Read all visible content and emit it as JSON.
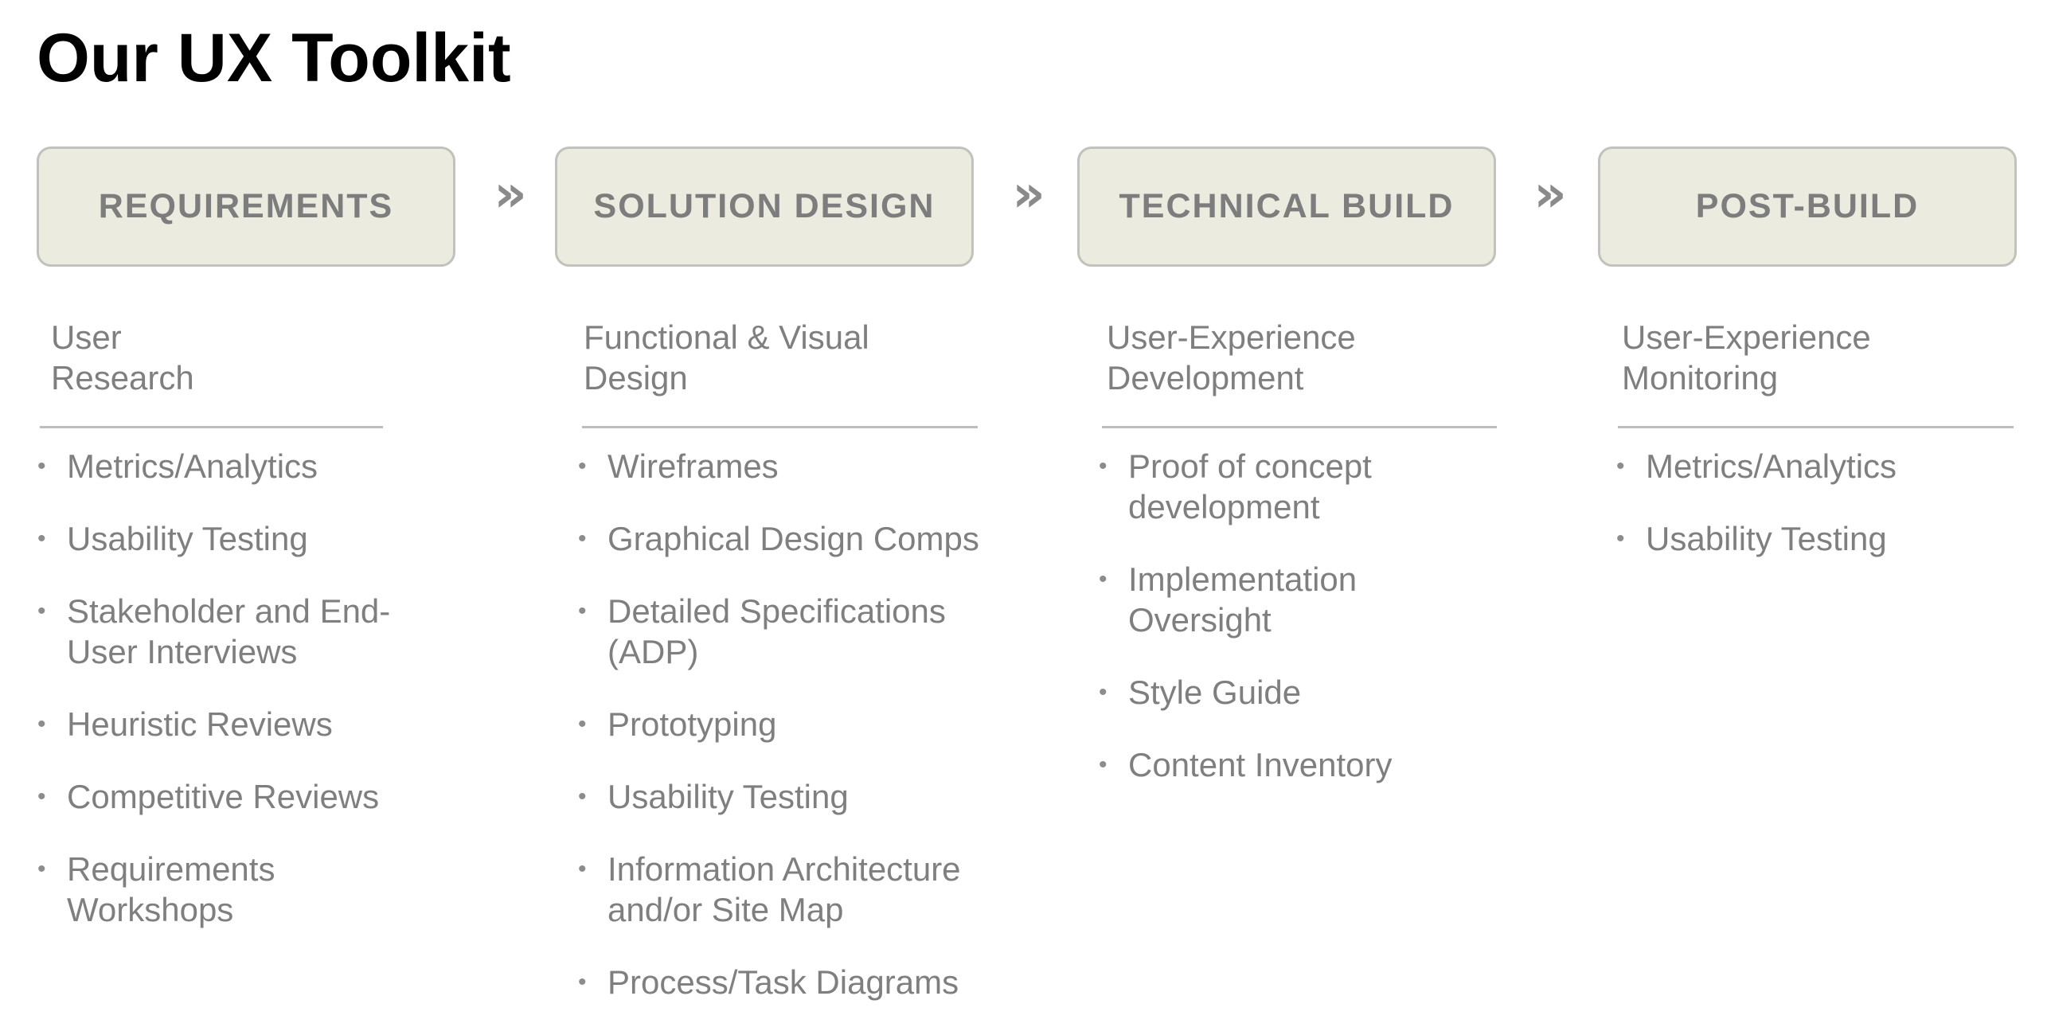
{
  "title": "Our UX Toolkit",
  "arrow_glyph": "»",
  "bullet_glyph": "•",
  "colors": {
    "box_fill": "#ebebdf",
    "box_border": "#c2c2bc",
    "text_gray": "#7f7f7f",
    "title": "#000000"
  },
  "stages": [
    {
      "label": "REQUIREMENTS",
      "heading": "User\nResearch",
      "items": [
        "Metrics/Analytics",
        "Usability Testing",
        "Stakeholder and End-\nUser Interviews",
        "Heuristic Reviews",
        "Competitive Reviews",
        "Requirements\nWorkshops"
      ]
    },
    {
      "label": "SOLUTION DESIGN",
      "heading": "Functional & Visual\nDesign",
      "items": [
        "Wireframes",
        "Graphical Design Comps",
        "Detailed Specifications\n(ADP)",
        "Prototyping",
        "Usability Testing",
        "Information Architecture\nand/or Site Map",
        "Process/Task Diagrams"
      ]
    },
    {
      "label": "TECHNICAL BUILD",
      "heading": "User-Experience\nDevelopment",
      "items": [
        "Proof of concept\ndevelopment",
        "Implementation\nOversight",
        "Style Guide",
        "Content Inventory"
      ]
    },
    {
      "label": "POST-BUILD",
      "heading": "User-Experience\nMonitoring",
      "items": [
        "Metrics/Analytics",
        "Usability Testing"
      ]
    }
  ]
}
